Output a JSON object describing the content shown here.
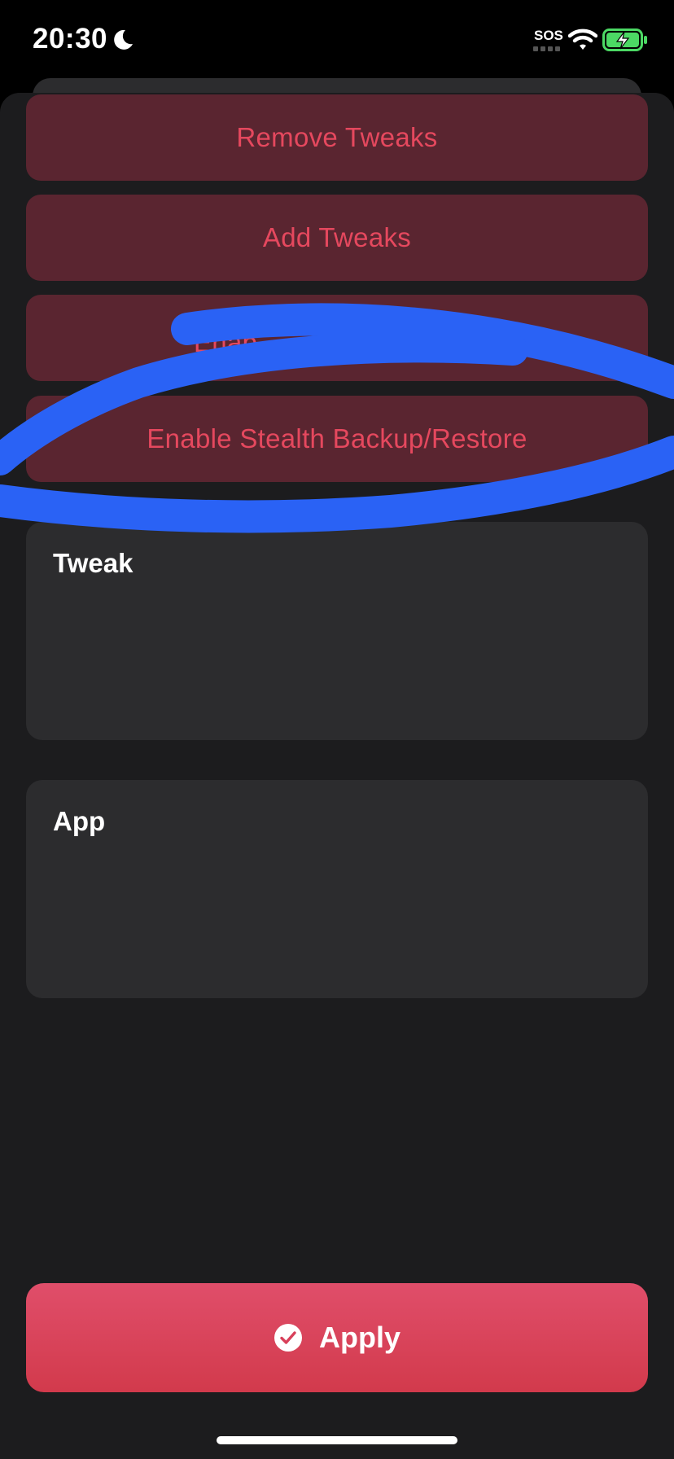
{
  "status_bar": {
    "time": "20:30",
    "sos": "SOS"
  },
  "actions": {
    "remove_tweaks": "Remove Tweaks",
    "add_tweaks": "Add Tweaks",
    "enable_obscured": "Enab",
    "enable_stealth": "Enable Stealth Backup/Restore"
  },
  "cards": {
    "tweak_title": "Tweak",
    "app_title": "App"
  },
  "apply": {
    "label": "Apply"
  },
  "colors": {
    "background": "#1c1c1e",
    "card": "#2c2c2e",
    "action_bg": "#5a2530",
    "action_text": "#e5485e",
    "apply_top": "#e04e6a",
    "apply_bottom": "#d23a4c",
    "scribble": "#2a62f5",
    "battery_fill": "#4cd964"
  },
  "icons": {
    "moon": "moon-icon",
    "wifi": "wifi-icon",
    "battery": "battery-charging-icon",
    "apply": "checkmark-circle-icon"
  }
}
